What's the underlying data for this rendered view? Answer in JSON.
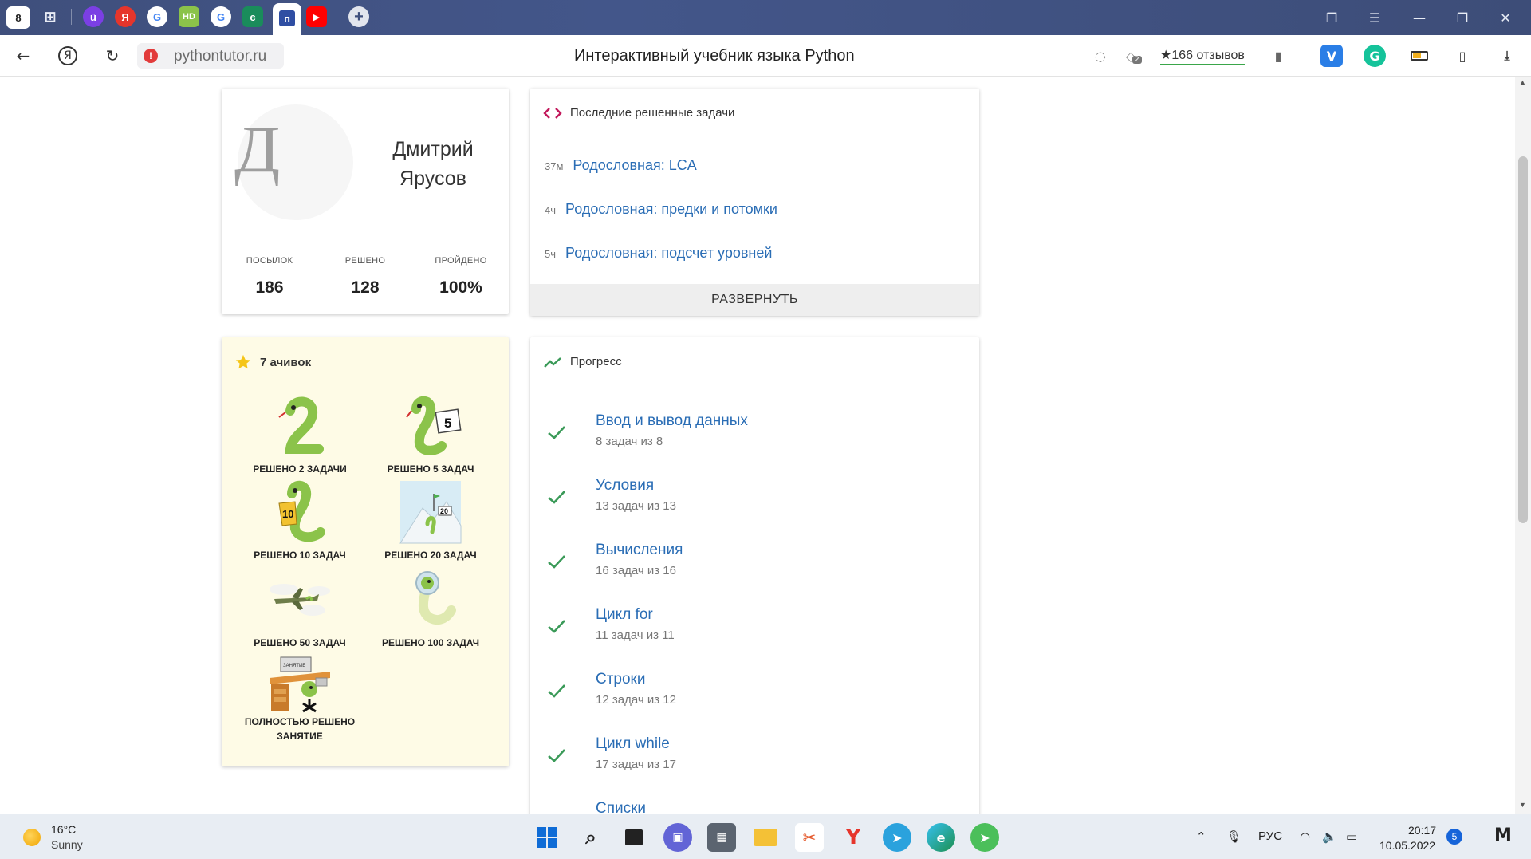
{
  "browser": {
    "tab_count_badge": "8",
    "url": "pythontutor.ru",
    "page_title": "Интерактивный учебник языка Python",
    "reviews": "★166 отзывов",
    "comments_badge": "2",
    "icons": [
      "home-icon",
      "new-tab-icon",
      "back-icon",
      "yandex-icon",
      "reload-icon",
      "warning-icon",
      "chat-icon",
      "bookmark-icon",
      "download-icon"
    ]
  },
  "profile": {
    "avatar_letter": "Д",
    "name": "Дмитрий Ярусов",
    "stats": [
      {
        "label": "ПОСЫЛОК",
        "value": "186"
      },
      {
        "label": "РЕШЕНО",
        "value": "128"
      },
      {
        "label": "ПРОЙДЕНО",
        "value": "100%"
      }
    ]
  },
  "recent": {
    "title": "Последние решенные задачи",
    "items": [
      {
        "time": "37м",
        "title": "Родословная: LCA"
      },
      {
        "time": "4ч",
        "title": "Родословная: предки и потомки"
      },
      {
        "time": "5ч",
        "title": "Родословная: подсчет уровней"
      }
    ],
    "expand_label": "РАЗВЕРНУТЬ"
  },
  "achievements": {
    "title": "7 ачивок",
    "items": [
      {
        "label": "РЕШЕНО 2 ЗАДАЧИ"
      },
      {
        "label": "РЕШЕНО 5 ЗАДАЧ",
        "sign": "5"
      },
      {
        "label": "РЕШЕНО 10 ЗАДАЧ",
        "sign": "10"
      },
      {
        "label": "РЕШЕНО 20 ЗАДАЧ",
        "sign": "20"
      },
      {
        "label": "РЕШЕНО 50 ЗАДАЧ"
      },
      {
        "label": "РЕШЕНО 100 ЗАДАЧ"
      },
      {
        "label": "ПОЛНОСТЬЮ РЕШЕНО ЗАНЯТИЕ"
      }
    ]
  },
  "progress": {
    "title": "Прогресс",
    "items": [
      {
        "title": "Ввод и вывод данных",
        "sub": "8 задач из 8"
      },
      {
        "title": "Условия",
        "sub": "13 задач из 13"
      },
      {
        "title": "Вычисления",
        "sub": "16 задач из 16"
      },
      {
        "title": "Цикл for",
        "sub": "11 задач из 11"
      },
      {
        "title": "Строки",
        "sub": "12 задач из 12"
      },
      {
        "title": "Цикл while",
        "sub": "17 задач из 17"
      },
      {
        "title": "Списки",
        "sub": ""
      }
    ]
  },
  "taskbar": {
    "weather_temp": "16°C",
    "weather_desc": "Sunny",
    "language": "РУС",
    "time": "20:17",
    "date": "10.05.2022",
    "notifications": "5"
  },
  "colors": {
    "link": "#2a6db5",
    "check": "#3a9a58",
    "achievements_bg": "#fefbe6",
    "tabbar": "#43568a"
  }
}
